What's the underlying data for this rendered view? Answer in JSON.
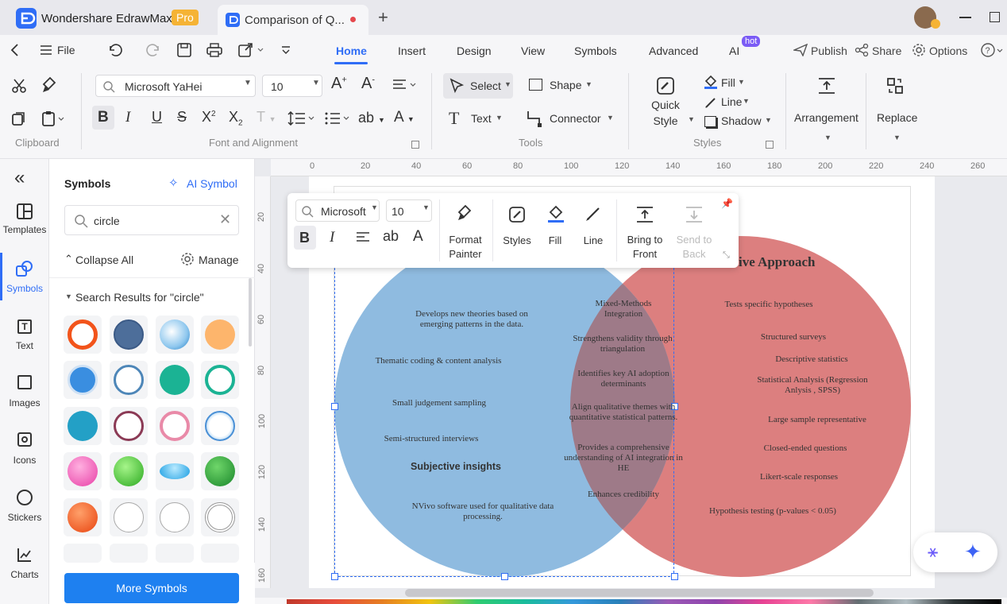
{
  "titlebar": {
    "app_name": "Wondershare EdrawMax",
    "pro_badge": "Pro",
    "doc_tab": "Comparison of Q...",
    "new_tab": "+"
  },
  "menubar": {
    "file": "File",
    "tabs": [
      "Home",
      "Insert",
      "Design",
      "View",
      "Symbols",
      "Advanced",
      "AI"
    ],
    "hot_badge": "hot",
    "publish": "Publish",
    "share": "Share",
    "options": "Options"
  },
  "ribbon": {
    "font_name": "Microsoft YaHei",
    "font_size": "10",
    "select": "Select",
    "shape": "Shape",
    "text": "Text",
    "connector": "Connector",
    "quick_style": "Quick Style",
    "fill": "Fill",
    "line": "Line",
    "shadow": "Shadow",
    "arrangement": "Arrangement",
    "replace": "Replace",
    "groups": {
      "clipboard": "Clipboard",
      "font": "Font and Alignment",
      "tools": "Tools",
      "styles": "Styles"
    }
  },
  "leftnav": {
    "collapse": "«",
    "items": [
      "Templates",
      "Symbols",
      "Text",
      "Images",
      "Icons",
      "Stickers",
      "Charts"
    ]
  },
  "symbols_panel": {
    "title": "Symbols",
    "ai_symbol": "AI Symbol",
    "search_value": "circle",
    "collapse_all": "Collapse All",
    "manage": "Manage",
    "results_header": "Search Results for  \"circle\"",
    "more_button": "More Symbols"
  },
  "ruler": {
    "h_ticks": [
      "0",
      "20",
      "40",
      "60",
      "80",
      "100",
      "120",
      "140",
      "160",
      "180",
      "200",
      "220",
      "240",
      "260"
    ],
    "v_ticks": [
      "20",
      "40",
      "60",
      "80",
      "100",
      "120",
      "140",
      "160"
    ]
  },
  "floatbar": {
    "font_name": "Microsoft",
    "font_size": "10",
    "format_painter": "Format Painter",
    "styles": "Styles",
    "fill": "Fill",
    "line": "Line",
    "bring_to_front": "Bring to Front",
    "send_to_back": "Send to Back"
  },
  "venn": {
    "right_title": "ive Approach",
    "left_items": [
      "Develops new theories based on emerging patterns in the data.",
      "Thematic coding & content analysis",
      "Small judgement sampling",
      "Semi-structured interviews",
      "Subjective insights",
      "NVivo software used for qualitative data processing."
    ],
    "middle_items": [
      "Mixed-Methods Integration",
      "Strengthens validity through triangulation",
      "Identifies key AI adoption determinants",
      "Align qualitative themes with quantitative statistical patterns.",
      "Provides a comprehensive understanding of AI integration in HE",
      "Enhances credibility"
    ],
    "right_items": [
      "Tests specific hypotheses",
      "Structured surveys",
      "Descriptive statistics",
      "Statistical Analysis (Regression Anlysis , SPSS)",
      "Large sample representative",
      "Closed-ended questions",
      "Likert-scale responses",
      "Hypothesis testing (p-values < 0.05)"
    ],
    "colors": {
      "left": "#8fbbe0",
      "right": "#dc7f7f",
      "overlap": "#9e7a88"
    }
  },
  "accent_color": "#2f6df6"
}
